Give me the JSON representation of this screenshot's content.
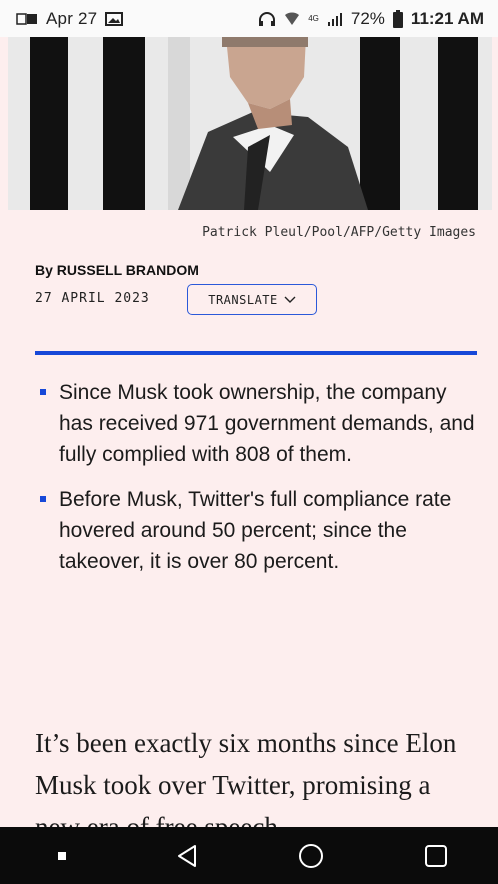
{
  "status_bar": {
    "date": "Apr 27",
    "network": "4G",
    "battery": "72%",
    "time": "11:21 AM"
  },
  "article": {
    "caption": "Patrick Pleul/Pool/AFP/Getty Images",
    "byline_prefix": "By ",
    "author": "RUSSELL BRANDOM",
    "date": "27 APRIL 2023",
    "translate_label": "TRANSLATE",
    "summary": [
      "Since Musk took ownership, the company has received 971 government demands, and fully complied with 808 of them.",
      "Before Musk, Twitter's full compliance rate hovered around 50 percent; since the takeover, it is over 80 percent."
    ],
    "body": "It’s been exactly six months since Elon Musk took over Twitter, promising a new era of free speech"
  },
  "colors": {
    "accent": "#1748d8",
    "page_background": "#fdeeee",
    "nav_background": "#0b0b0b"
  },
  "icons": {
    "status": [
      "gallery-icon",
      "image-icon",
      "headphones-icon",
      "wifi-icon",
      "signal-icon",
      "battery-icon"
    ],
    "nav": [
      "recent-apps-icon",
      "back-icon",
      "home-icon",
      "overview-icon"
    ]
  }
}
